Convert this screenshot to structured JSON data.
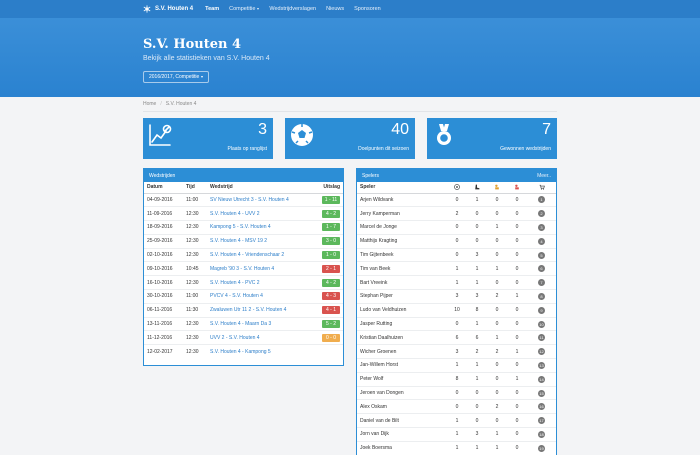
{
  "navbar": {
    "brand": "S.V. Houten 4",
    "items": [
      {
        "label": "Team",
        "bold": true,
        "dropdown": false
      },
      {
        "label": "Competitie",
        "bold": false,
        "dropdown": true
      },
      {
        "label": "Wedstrijdverslagen",
        "bold": false,
        "dropdown": false
      },
      {
        "label": "Nieuws",
        "bold": false,
        "dropdown": false
      },
      {
        "label": "Sponsoren",
        "bold": false,
        "dropdown": false
      }
    ]
  },
  "hero": {
    "title": "S.V. Houten 4",
    "subtitle": "Bekijk alle statistieken van S.V. Houten 4",
    "season_button": "2016/2017, Competitie"
  },
  "breadcrumb": [
    "Home",
    "S.V. Houten 4"
  ],
  "stats": [
    {
      "value": "3",
      "label": "Plaats op ranglijst",
      "icon": "chart-icon"
    },
    {
      "value": "40",
      "label": "Doelpunten dit seizoen",
      "icon": "football-icon"
    },
    {
      "value": "7",
      "label": "Gewonnen wedstrijden",
      "icon": "medal-icon"
    }
  ],
  "matches": {
    "title": "Wedstrijden",
    "headers": [
      "Datum",
      "Tijd",
      "Wedstrijd",
      "Uitslag"
    ],
    "rows": [
      {
        "date": "04-09-2016",
        "time": "11:00",
        "match": "SV Nieuw Utrecht 3 - S.V. Houten 4",
        "result": "1 - 11",
        "status": "win"
      },
      {
        "date": "11-09-2016",
        "time": "12:30",
        "match": "S.V. Houten 4 - UVV 2",
        "result": "4 - 2",
        "status": "win"
      },
      {
        "date": "18-09-2016",
        "time": "12:30",
        "match": "Kampong 5 - S.V. Houten 4",
        "result": "1 - 7",
        "status": "win"
      },
      {
        "date": "25-09-2016",
        "time": "12:30",
        "match": "S.V. Houten 4 - MSV 19 2",
        "result": "3 - 0",
        "status": "win"
      },
      {
        "date": "02-10-2016",
        "time": "12:30",
        "match": "S.V. Houten 4 - Vriendenschaar 2",
        "result": "1 - 0",
        "status": "win"
      },
      {
        "date": "09-10-2016",
        "time": "10:45",
        "match": "Magreb '90 3 - S.V. Houten 4",
        "result": "2 - 1",
        "status": "loss"
      },
      {
        "date": "16-10-2016",
        "time": "12:30",
        "match": "S.V. Houten 4 - PVC 2",
        "result": "4 - 2",
        "status": "win"
      },
      {
        "date": "30-10-2016",
        "time": "11:00",
        "match": "PVCV 4 - S.V. Houten 4",
        "result": "4 - 3",
        "status": "loss"
      },
      {
        "date": "06-11-2016",
        "time": "11:30",
        "match": "Zwaluwen Utr 11 2 - S.V. Houten 4",
        "result": "4 - 1",
        "status": "loss"
      },
      {
        "date": "13-11-2016",
        "time": "12:30",
        "match": "S.V. Houten 4 - Maarn Da 3",
        "result": "5 - 2",
        "status": "win"
      },
      {
        "date": "11-12-2016",
        "time": "12:30",
        "match": "UVV 2 - S.V. Houten 4",
        "result": "0 - 0",
        "status": "draw"
      },
      {
        "date": "12-02-2017",
        "time": "12:30",
        "match": "S.V. Houten 4 - Kampong 5",
        "result": "",
        "status": ""
      }
    ]
  },
  "players": {
    "title": "Spelers",
    "more": "Meer..",
    "headers": {
      "name": "Speler",
      "icons": [
        "football-icon",
        "boot-icon",
        "yellow-card-icon",
        "red-card-icon",
        "cart-icon"
      ]
    },
    "rows": [
      {
        "name": "Arjen Wildvank",
        "c1": "0",
        "c2": "1",
        "c3": "0",
        "c4": "0",
        "rank": "1"
      },
      {
        "name": "Jerry Kamperman",
        "c1": "2",
        "c2": "0",
        "c3": "0",
        "c4": "0",
        "rank": "2"
      },
      {
        "name": "Marcel de Jonge",
        "c1": "0",
        "c2": "0",
        "c3": "1",
        "c4": "0",
        "rank": "3"
      },
      {
        "name": "Matthijs Kragting",
        "c1": "0",
        "c2": "0",
        "c3": "0",
        "c4": "0",
        "rank": "4"
      },
      {
        "name": "Tim Gijtenbeek",
        "c1": "0",
        "c2": "3",
        "c3": "0",
        "c4": "0",
        "rank": "5"
      },
      {
        "name": "Tim van Beek",
        "c1": "1",
        "c2": "1",
        "c3": "1",
        "c4": "0",
        "rank": "6"
      },
      {
        "name": "Bart Vreeink",
        "c1": "1",
        "c2": "1",
        "c3": "0",
        "c4": "0",
        "rank": "7"
      },
      {
        "name": "Stephan Pijper",
        "c1": "3",
        "c2": "3",
        "c3": "2",
        "c4": "1",
        "rank": "8"
      },
      {
        "name": "Ludo van Veldhuizen",
        "c1": "10",
        "c2": "8",
        "c3": "0",
        "c4": "0",
        "rank": "9"
      },
      {
        "name": "Jasper Rutting",
        "c1": "0",
        "c2": "1",
        "c3": "0",
        "c4": "0",
        "rank": "10"
      },
      {
        "name": "Kristian Daalhuizen",
        "c1": "6",
        "c2": "6",
        "c3": "1",
        "c4": "0",
        "rank": "11"
      },
      {
        "name": "Wicher Groenen",
        "c1": "3",
        "c2": "2",
        "c3": "2",
        "c4": "1",
        "rank": "12"
      },
      {
        "name": "Jan-Willem Horst",
        "c1": "1",
        "c2": "1",
        "c3": "0",
        "c4": "0",
        "rank": "13"
      },
      {
        "name": "Peter Wolf",
        "c1": "8",
        "c2": "1",
        "c3": "0",
        "c4": "1",
        "rank": "14"
      },
      {
        "name": "Jeroen van Dongen",
        "c1": "0",
        "c2": "0",
        "c3": "0",
        "c4": "0",
        "rank": "15"
      },
      {
        "name": "Alex Oskam",
        "c1": "0",
        "c2": "0",
        "c3": "2",
        "c4": "0",
        "rank": "16"
      },
      {
        "name": "Daniel van de Bilt",
        "c1": "1",
        "c2": "0",
        "c3": "0",
        "c4": "0",
        "rank": "17"
      },
      {
        "name": "Jorn van Dijk",
        "c1": "1",
        "c2": "3",
        "c3": "1",
        "c4": "0",
        "rank": "18"
      },
      {
        "name": "Joek Boersma",
        "c1": "1",
        "c2": "1",
        "c3": "1",
        "c4": "0",
        "rank": "19"
      }
    ]
  },
  "colors": {
    "brand": "#2c7ec9",
    "win": "#5cb85c",
    "loss": "#d9534f",
    "draw": "#f0ad4e"
  }
}
